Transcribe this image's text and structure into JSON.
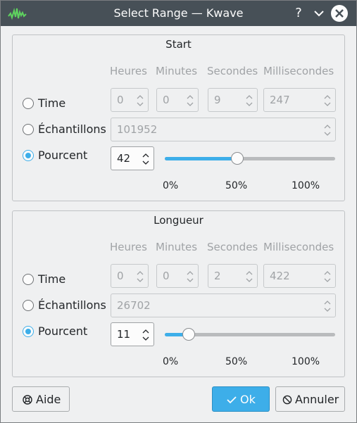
{
  "window": {
    "title": "Select Range — Kwave"
  },
  "titlebar": {
    "help_glyph": "?",
    "icons": [
      "kwave-app-icon",
      "help-icon",
      "minimize-icon",
      "close-icon"
    ]
  },
  "start": {
    "title": "Start",
    "headers": {
      "hours": "Heures",
      "minutes": "Minutes",
      "seconds": "Secondes",
      "ms": "Millisecondes"
    },
    "time": {
      "label": "Time",
      "hours": "0",
      "minutes": "0",
      "seconds": "9",
      "ms": "247"
    },
    "samples": {
      "label": "Échantillons",
      "value": "101952"
    },
    "percent": {
      "label": "Pourcent",
      "value": "42",
      "level": 0.42
    },
    "ticks": {
      "min": "0%",
      "mid": "50%",
      "max": "100%"
    },
    "selected_mode": "percent"
  },
  "length": {
    "title": "Longueur",
    "headers": {
      "hours": "Heures",
      "minutes": "Minutes",
      "seconds": "Secondes",
      "ms": "Millisecondes"
    },
    "time": {
      "label": "Time",
      "hours": "0",
      "minutes": "0",
      "seconds": "2",
      "ms": "422"
    },
    "samples": {
      "label": "Échantillons",
      "value": "26702"
    },
    "percent": {
      "label": "Pourcent",
      "value": "11",
      "level": 0.11
    },
    "ticks": {
      "min": "0%",
      "mid": "50%",
      "max": "100%"
    },
    "selected_mode": "percent"
  },
  "buttons": {
    "help": "Aide",
    "ok": "Ok",
    "cancel": "Annuler"
  },
  "colors": {
    "accent": "#3daee9",
    "titlebar": "#475057",
    "window_bg": "#eff0f1"
  }
}
